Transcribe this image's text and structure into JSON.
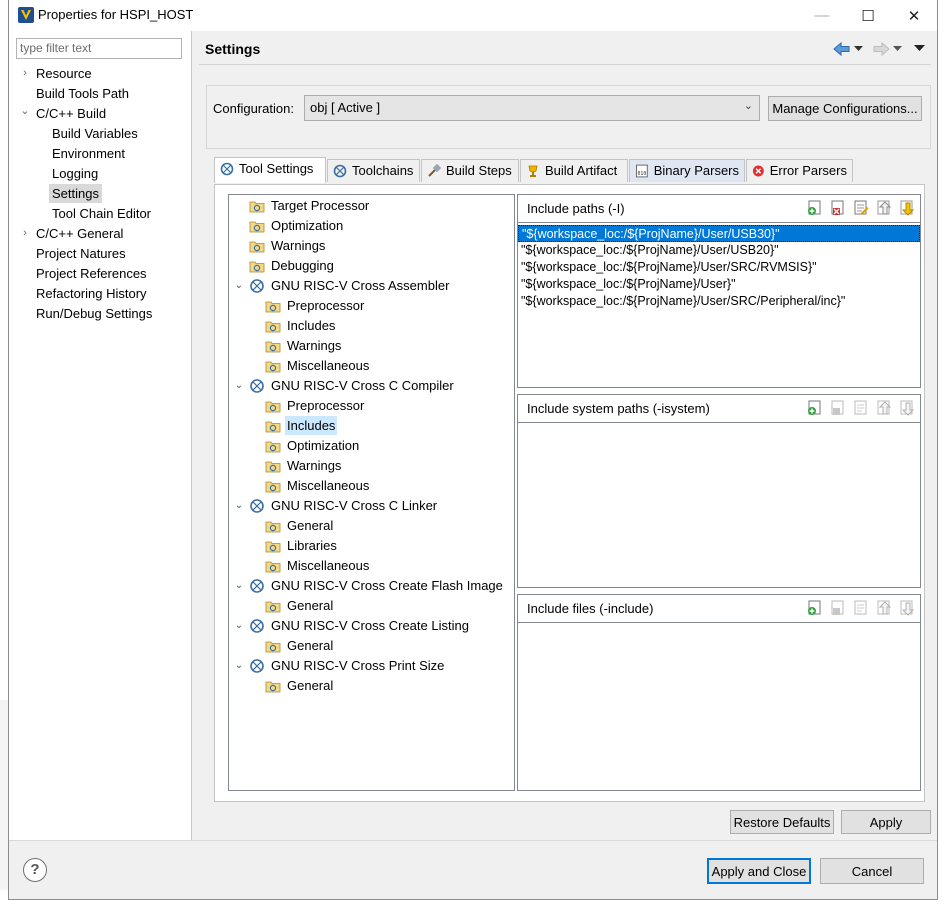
{
  "window": {
    "title": "Properties for HSPI_HOST",
    "controls": {
      "minimize": "—",
      "maximize": "☐",
      "close": "✕"
    }
  },
  "sidebar": {
    "filter_placeholder": "type filter text",
    "items": [
      {
        "label": "Resource",
        "expander": "›"
      },
      {
        "label": "Build Tools Path"
      },
      {
        "label": "C/C++ Build",
        "expander": "⌄"
      },
      {
        "label": "Build Variables"
      },
      {
        "label": "Environment"
      },
      {
        "label": "Logging"
      },
      {
        "label": "Settings",
        "selected": true
      },
      {
        "label": "Tool Chain Editor"
      },
      {
        "label": "C/C++ General",
        "expander": "›"
      },
      {
        "label": "Project Natures"
      },
      {
        "label": "Project References"
      },
      {
        "label": "Refactoring History"
      },
      {
        "label": "Run/Debug Settings"
      }
    ]
  },
  "header": {
    "title": "Settings"
  },
  "configuration": {
    "label": "Configuration:",
    "value": "obj  [ Active ]",
    "manage_button": "Manage Configurations..."
  },
  "tabs": [
    {
      "label": "Tool Settings",
      "active": true
    },
    {
      "label": "Toolchains"
    },
    {
      "label": "Build Steps"
    },
    {
      "label": "Build Artifact"
    },
    {
      "label": "Binary Parsers"
    },
    {
      "label": "Error Parsers"
    }
  ],
  "tool_tree": [
    {
      "label": "Target Processor"
    },
    {
      "label": "Optimization"
    },
    {
      "label": "Warnings"
    },
    {
      "label": "Debugging"
    },
    {
      "label": "GNU RISC-V Cross Assembler",
      "group": true
    },
    {
      "label": "Preprocessor"
    },
    {
      "label": "Includes"
    },
    {
      "label": "Warnings"
    },
    {
      "label": "Miscellaneous"
    },
    {
      "label": "GNU RISC-V Cross C Compiler",
      "group": true
    },
    {
      "label": "Preprocessor"
    },
    {
      "label": "Includes",
      "selected": true
    },
    {
      "label": "Optimization"
    },
    {
      "label": "Warnings"
    },
    {
      "label": "Miscellaneous"
    },
    {
      "label": "GNU RISC-V Cross C Linker",
      "group": true
    },
    {
      "label": "General"
    },
    {
      "label": "Libraries"
    },
    {
      "label": "Miscellaneous"
    },
    {
      "label": "GNU RISC-V Cross Create Flash Image",
      "group": true
    },
    {
      "label": "General"
    },
    {
      "label": "GNU RISC-V Cross Create Listing",
      "group": true
    },
    {
      "label": "General"
    },
    {
      "label": "GNU RISC-V Cross Print Size",
      "group": true
    },
    {
      "label": "General"
    }
  ],
  "include_paths": {
    "title": "Include paths (-I)",
    "entries": [
      "\"${workspace_loc:/${ProjName}/User/USB30}\"",
      "\"${workspace_loc:/${ProjName}/User/USB20}\"",
      "\"${workspace_loc:/${ProjName}/User/SRC/RVMSIS}\"",
      "\"${workspace_loc:/${ProjName}/User}\"",
      "\"${workspace_loc:/${ProjName}/User/SRC/Peripheral/inc}\""
    ]
  },
  "include_system_paths": {
    "title": "Include system paths (-isystem)",
    "entries": []
  },
  "include_files": {
    "title": "Include files (-include)",
    "entries": []
  },
  "buttons": {
    "restore_defaults": "Restore Defaults",
    "apply": "Apply",
    "apply_and_close": "Apply and Close",
    "cancel": "Cancel",
    "help": "?"
  },
  "colors": {
    "selection": "#0078d7",
    "tree_selection": "#cce8ff",
    "accent": "#0078d7"
  }
}
